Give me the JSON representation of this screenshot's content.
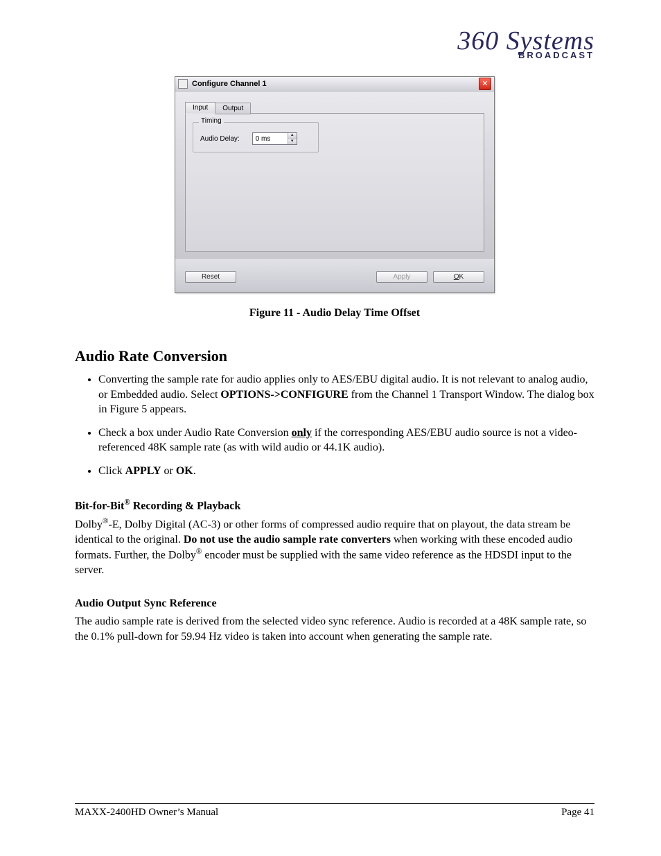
{
  "logo": {
    "script": "360 Systems",
    "broadcast": "BROADCAST"
  },
  "dialog": {
    "title": "Configure Channel 1",
    "close": "✕",
    "tabs": {
      "input": "Input",
      "output": "Output"
    },
    "group_legend": "Timing",
    "audio_delay_label": "Audio Delay:",
    "audio_delay_value": "0 ms",
    "buttons": {
      "reset": "Reset",
      "apply": "Apply",
      "ok": "OK"
    }
  },
  "fig_caption": "Figure 11 - Audio Delay Time Offset",
  "section_heading": "Audio Rate Conversion",
  "bullets": {
    "b1a": "Converting the sample rate for audio applies only to AES/EBU digital audio. It is not relevant to analog audio, or Embedded audio. Select ",
    "b1_bold": "OPTIONS->CONFIGURE",
    "b1b": " from the Channel 1 Transport Window. The dialog box in Figure 5 appears.",
    "b2a": "Check a box under Audio Rate Conversion ",
    "b2_only": "only",
    "b2b": " if the corresponding AES/EBU audio source is not a video-referenced 48K sample rate (as with wild audio or 44.1K audio).",
    "b3a": "Click ",
    "b3_apply": "APPLY",
    "b3_or": " or ",
    "b3_ok": "OK",
    "b3b": "."
  },
  "subhead1a": "Bit-for-Bit",
  "subhead1_reg": "®",
  "subhead1b": " Recording & Playback",
  "para1a": "Dolby",
  "para1_reg1": "®",
  "para1b": "‑E, Dolby Digital (AC-3) or other forms of compressed audio require that on playout, the data stream be identical to the original.  ",
  "para1_bold": "Do not use the audio sample rate converters",
  "para1c": " when working with these encoded audio formats. Further, the Dolby",
  "para1_reg2": "®",
  "para1d": " encoder must be supplied with the same video reference as the HDSDI input to the server.",
  "subhead2": "Audio Output Sync Reference",
  "para2": "The audio sample rate is derived from the selected video sync reference.  Audio is recorded at a 48K sample rate, so the 0.1% pull-down for 59.94 Hz video is taken into account when generating the sample rate.",
  "footer": {
    "left": "MAXX-2400HD Owner’s Manual",
    "right": "Page 41"
  }
}
